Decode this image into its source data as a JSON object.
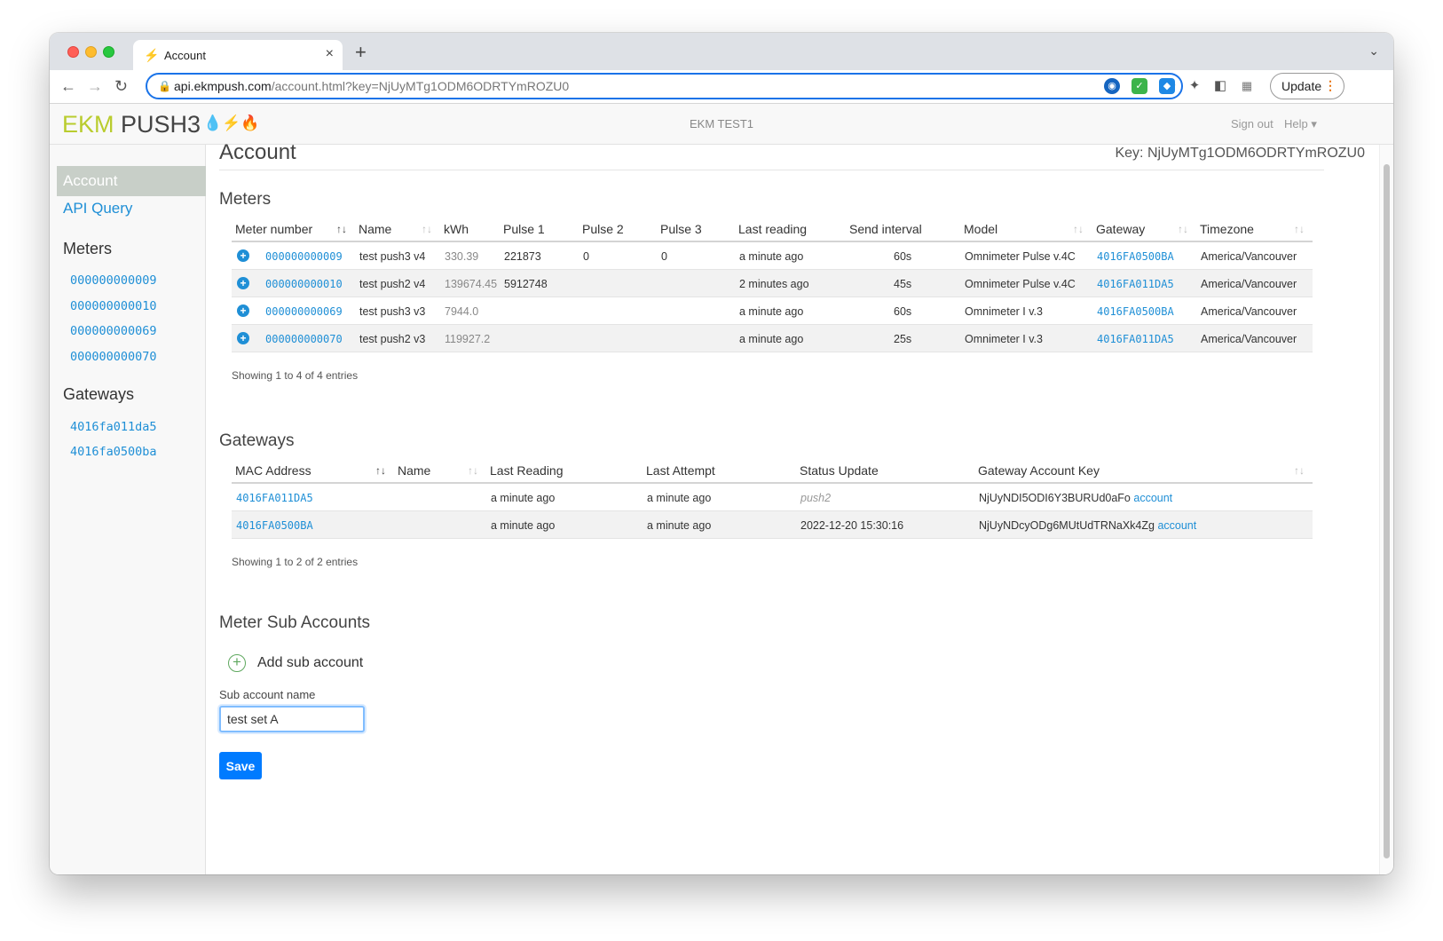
{
  "browser": {
    "tab_title": "Account",
    "url_host": "api.ekmpush.com",
    "url_path": "/account.html?key=NjUyMTg1ODM6ODRTYmROZU0",
    "update_label": "Update"
  },
  "app": {
    "brand_ekm": "EKM",
    "brand_push": "PUSH3",
    "brand_icons": "💧⚡🔥",
    "account_name": "EKM TEST1",
    "sign_out": "Sign out",
    "help": "Help ▾"
  },
  "sidebar": {
    "active": "Account",
    "api_query": "API Query",
    "meters_heading": "Meters",
    "meters": [
      "000000000009",
      "000000000010",
      "000000000069",
      "000000000070"
    ],
    "gateways_heading": "Gateways",
    "gateways": [
      "4016fa011da5",
      "4016fa0500ba"
    ]
  },
  "page": {
    "title": "Account",
    "key": "Key: NjUyMTg1ODM6ODRTYmROZU0"
  },
  "meters": {
    "title": "Meters",
    "headers": [
      "Meter number",
      "Name",
      "kWh",
      "Pulse 1",
      "Pulse 2",
      "Pulse 3",
      "Last reading",
      "Send interval",
      "Model",
      "Gateway",
      "Timezone"
    ],
    "rows": [
      {
        "meter": "000000000009",
        "name": "test push3 v4",
        "kwh": "330.39",
        "pulse1": "221873",
        "pulse2": "0",
        "pulse3": "0",
        "last": "a minute ago",
        "interval": "60s",
        "model": "Omnimeter Pulse v.4C",
        "gateway": "4016FA0500BA",
        "tz": "America/Vancouver"
      },
      {
        "meter": "000000000010",
        "name": "test push2 v4",
        "kwh": "139674.45",
        "pulse1": "5912748",
        "pulse2": "",
        "pulse3": "",
        "last": "2 minutes ago",
        "interval": "45s",
        "model": "Omnimeter Pulse v.4C",
        "gateway": "4016FA011DA5",
        "tz": "America/Vancouver"
      },
      {
        "meter": "000000000069",
        "name": "test push3 v3",
        "kwh": "7944.0",
        "pulse1": "",
        "pulse2": "",
        "pulse3": "",
        "last": "a minute ago",
        "interval": "60s",
        "model": "Omnimeter I v.3",
        "gateway": "4016FA0500BA",
        "tz": "America/Vancouver"
      },
      {
        "meter": "000000000070",
        "name": "test push2 v3",
        "kwh": "119927.2",
        "pulse1": "",
        "pulse2": "",
        "pulse3": "",
        "last": "a minute ago",
        "interval": "25s",
        "model": "Omnimeter I v.3",
        "gateway": "4016FA011DA5",
        "tz": "America/Vancouver"
      }
    ],
    "showing": "Showing 1 to 4 of 4 entries"
  },
  "gateways": {
    "title": "Gateways",
    "headers": [
      "MAC Address",
      "Name",
      "Last Reading",
      "Last Attempt",
      "Status Update",
      "Gateway Account Key"
    ],
    "rows": [
      {
        "mac": "4016FA011DA5",
        "name": "",
        "last_reading": "a minute ago",
        "last_attempt": "a minute ago",
        "status": "push2",
        "key": "NjUyNDI5ODI6Y3BURUd0aFo",
        "link": "account"
      },
      {
        "mac": "4016FA0500BA",
        "name": "",
        "last_reading": "a minute ago",
        "last_attempt": "a minute ago",
        "status": "2022-12-20 15:30:16",
        "key": "NjUyNDcyODg6MUtUdTRNaXk4Zg",
        "link": "account"
      }
    ],
    "showing": "Showing 1 to 2 of 2 entries"
  },
  "sub_accounts": {
    "title": "Meter Sub Accounts",
    "add_label": "Add sub account",
    "field_label": "Sub account name",
    "field_value": "test set A",
    "save_label": "Save"
  }
}
